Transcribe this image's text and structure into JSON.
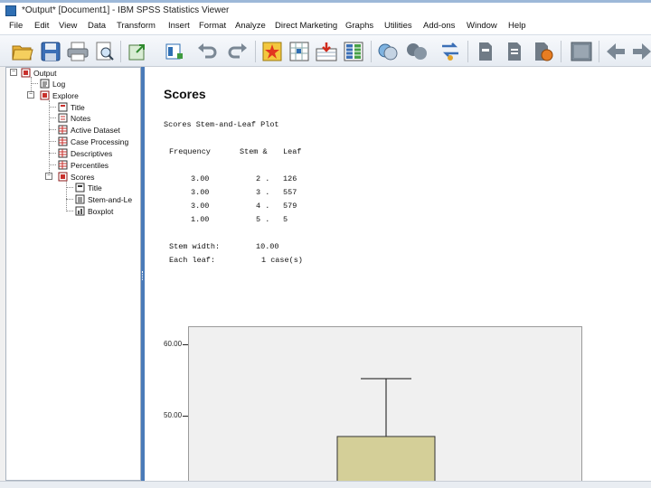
{
  "window": {
    "title": "*Output* [Document1] - IBM SPSS Statistics Viewer"
  },
  "menu": [
    "File",
    "Edit",
    "View",
    "Data",
    "Transform",
    "Insert",
    "Format",
    "Analyze",
    "Direct Marketing",
    "Graphs",
    "Utilities",
    "Add-ons",
    "Window",
    "Help"
  ],
  "toolbar": {
    "buttons": [
      "open-icon",
      "save-icon",
      "print-icon",
      "print-preview-icon",
      "export-icon",
      "recall-dialog-icon",
      "undo-icon",
      "redo-icon",
      "goto-case-icon",
      "goto-variable-icon",
      "variables-icon",
      "use-sets-icon",
      "show-all-variables-icon",
      "designate-window-icon",
      "promote-icon",
      "demote-icon",
      "insert-heading-icon",
      "insert-title-icon",
      "insert-text-icon",
      "script-icon",
      "hide-icon",
      "back-icon",
      "forward-icon"
    ]
  },
  "outline": {
    "items": [
      {
        "label": "Output",
        "icon": "output-book-icon"
      },
      {
        "label": "Log",
        "icon": "log-icon"
      },
      {
        "label": "Explore",
        "icon": "procedure-book-icon"
      },
      {
        "label": "Title",
        "icon": "title-icon"
      },
      {
        "label": "Notes",
        "icon": "notes-icon"
      },
      {
        "label": "Active Dataset",
        "icon": "table-icon"
      },
      {
        "label": "Case Processing",
        "icon": "table-icon"
      },
      {
        "label": "Descriptives",
        "icon": "table-icon"
      },
      {
        "label": "Percentiles",
        "icon": "table-icon"
      },
      {
        "label": "Scores",
        "icon": "book-icon"
      },
      {
        "label": "Title",
        "icon": "title-icon"
      },
      {
        "label": "Stem-and-Le",
        "icon": "text-output-icon"
      },
      {
        "label": "Boxplot",
        "icon": "chart-icon"
      }
    ]
  },
  "content": {
    "heading": "Scores",
    "plot_title": "Scores Stem-and-Leaf Plot",
    "header": {
      "frequency": "Frequency",
      "stem": "Stem &",
      "leaf": "Leaf"
    },
    "rows": [
      {
        "frequency": "3.00",
        "stem": "2 .",
        "leaf": "126"
      },
      {
        "frequency": "3.00",
        "stem": "3 .",
        "leaf": "557"
      },
      {
        "frequency": "3.00",
        "stem": "4 .",
        "leaf": "579"
      },
      {
        "frequency": "1.00",
        "stem": "5 .",
        "leaf": "5"
      }
    ],
    "stem_width_label": "Stem width:",
    "stem_width_value": "10.00",
    "each_leaf_label": "Each leaf:",
    "each_leaf_value": "1 case(s)"
  },
  "boxplot": {
    "y_ticks": [
      "60.00",
      "50.00"
    ],
    "box_color": "#d4cf98"
  },
  "chart_data": {
    "type": "boxplot",
    "y_ticks": [
      60,
      50
    ],
    "whisker_top": 55,
    "box_top": 47
  }
}
